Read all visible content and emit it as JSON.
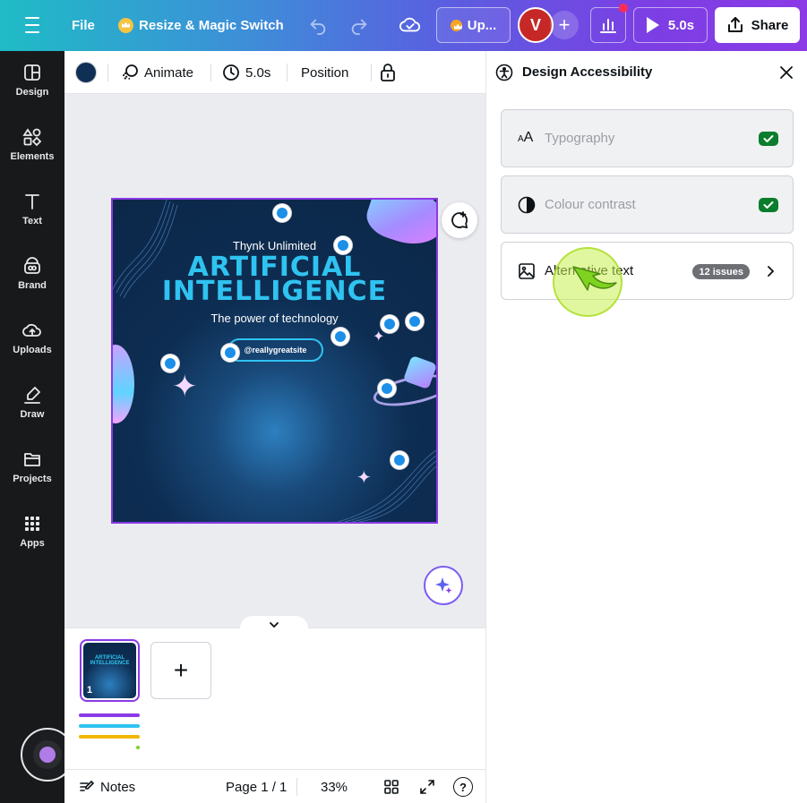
{
  "topbar": {
    "file_label": "File",
    "resize_label": "Resize & Magic Switch",
    "upgrade_label": "Up...",
    "avatar_initial": "V",
    "play_duration": "5.0s",
    "share_label": "Share"
  },
  "rail": {
    "items": [
      {
        "label": "Design",
        "icon": "design-icon"
      },
      {
        "label": "Elements",
        "icon": "elements-icon"
      },
      {
        "label": "Text",
        "icon": "text-icon"
      },
      {
        "label": "Brand",
        "icon": "brand-icon"
      },
      {
        "label": "Uploads",
        "icon": "uploads-icon"
      },
      {
        "label": "Draw",
        "icon": "draw-icon"
      },
      {
        "label": "Projects",
        "icon": "projects-icon"
      },
      {
        "label": "Apps",
        "icon": "apps-icon"
      }
    ]
  },
  "toolbar": {
    "color": "#0f2f55",
    "animate_label": "Animate",
    "duration_label": "5.0s",
    "position_label": "Position"
  },
  "design": {
    "brand": "Thynk Unlimited",
    "title_line1": "ARTIFICIAL",
    "title_line2": "INTELLIGENCE",
    "subtitle": "The power of technology",
    "website": "@reallygreatsite"
  },
  "pages": {
    "thumb_title": "ARTIFICIAL INTELLIGENCE",
    "current_number": "1",
    "add_symbol": "+"
  },
  "status": {
    "notes_label": "Notes",
    "page_indicator": "Page 1 / 1",
    "zoom": "33%",
    "help_symbol": "?"
  },
  "panel": {
    "title": "Design Accessibility",
    "checks": [
      {
        "label": "Typography",
        "state": "passed",
        "icon": "typography-icon"
      },
      {
        "label": "Colour contrast",
        "state": "passed",
        "icon": "contrast-icon"
      },
      {
        "label": "Alternative text",
        "state": "issues",
        "badge": "12 issues",
        "icon": "image-icon"
      }
    ]
  },
  "colors": {
    "accent_purple": "#8b3ae6",
    "success_green": "#0a7d2c",
    "rail_bg": "#18191b",
    "title_cyan": "#2fc3f0"
  }
}
